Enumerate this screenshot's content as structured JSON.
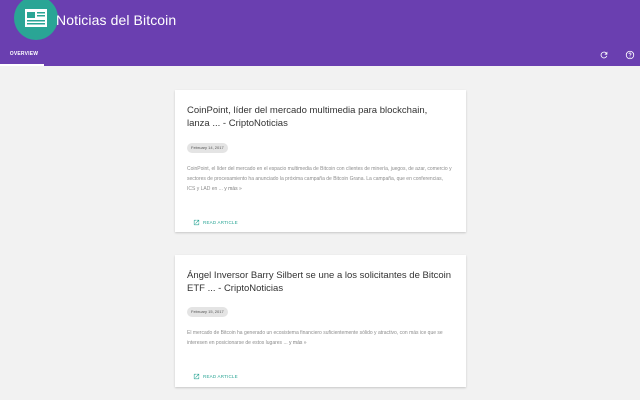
{
  "app": {
    "title": "Noticias del Bitcoin",
    "logo_icon": "newspaper-icon",
    "accent": "#6a3fb0",
    "logo_color": "#2aa595"
  },
  "tabs": [
    {
      "label": "OVERVIEW",
      "active": true
    }
  ],
  "toolbar": {
    "refresh_icon": "refresh-icon",
    "help_icon": "help-icon"
  },
  "articles": [
    {
      "title": "CoinPoint, líder del mercado multimedia para blockchain, lanza ... - CriptoNoticias",
      "date": "February 14, 2017",
      "summary": "CoinPoint, el líder del mercado en el espacio multimedia de Bitcoin con clientes de minería, juegos, de azar, comercio y sectores de procesamiento ha anunciado la próxima campaña de Bitcoin Grana. La campaña, que en conferencias, ICS y LAD en ...",
      "more": "y más »",
      "action": "READ ARTICLE"
    },
    {
      "title": "Ángel Inversor Barry Silbert se une a los solicitantes de Bitcoin ETF ... - CriptoNoticias",
      "date": "February 15, 2017",
      "summary": "El mercado de Bitcoin ha generado un ecosistema financiero suficientemente sólido y atractivo, con más ice que se interesen en posicionarse de estos lugares ...",
      "more": "y más »",
      "action": "READ ARTICLE"
    }
  ]
}
